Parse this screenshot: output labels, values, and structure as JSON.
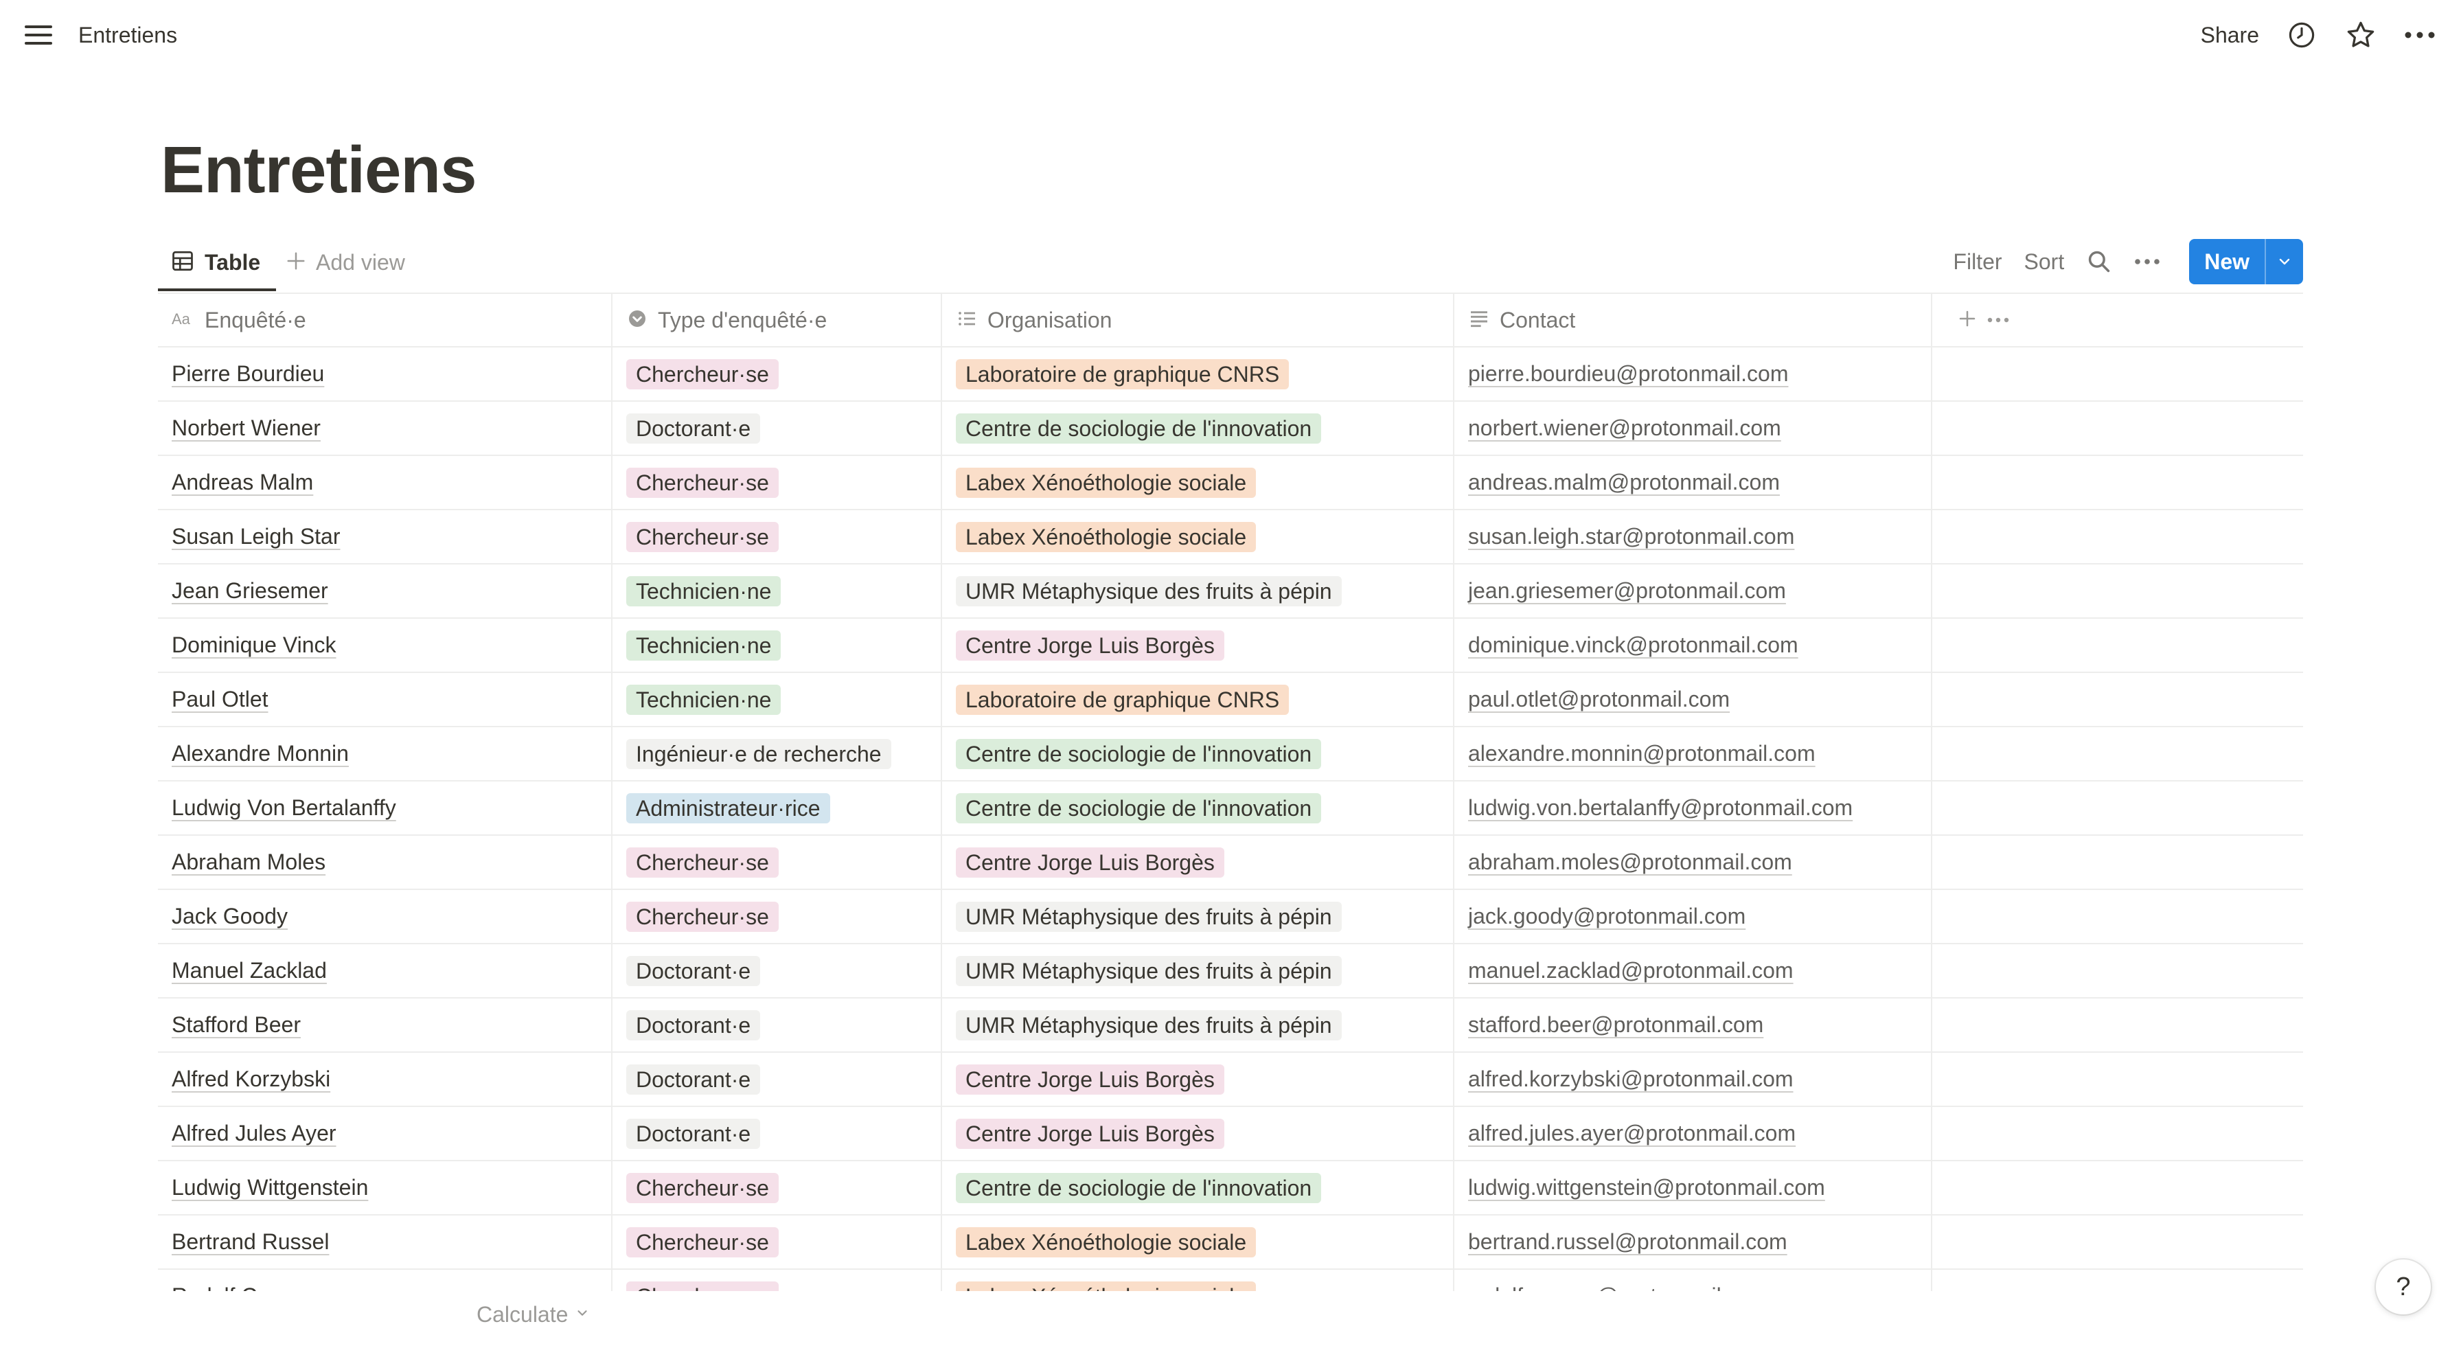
{
  "topbar": {
    "breadcrumb": "Entretiens",
    "share_label": "Share"
  },
  "page": {
    "title": "Entretiens"
  },
  "views": {
    "active_tab": "Table",
    "add_view_label": "Add view",
    "filter_label": "Filter",
    "sort_label": "Sort",
    "new_label": "New"
  },
  "columns": [
    {
      "label": "Enquêté·e",
      "icon": "text-aa-icon"
    },
    {
      "label": "Type d'enquêté·e",
      "icon": "select-icon"
    },
    {
      "label": "Organisation",
      "icon": "list-icon"
    },
    {
      "label": "Contact",
      "icon": "text-icon"
    }
  ],
  "tag_colors": {
    "pink": "#f5e0e9",
    "gray": "#f1f1ef",
    "green": "#dbeddb",
    "blue": "#d3e5ef",
    "orange": "#fadec9",
    "accent": "#2383e2"
  },
  "rows": [
    {
      "name": "Pierre Bourdieu",
      "type": "Chercheur·se",
      "type_color": "#f5e0e9",
      "org": "Laboratoire de graphique CNRS",
      "org_color": "#fadec9",
      "email": "pierre.bourdieu@protonmail.com"
    },
    {
      "name": "Norbert Wiener",
      "type": "Doctorant·e",
      "type_color": "#f1f1ef",
      "org": "Centre de sociologie de l'innovation",
      "org_color": "#dbeddb",
      "email": "norbert.wiener@protonmail.com"
    },
    {
      "name": "Andreas Malm",
      "type": "Chercheur·se",
      "type_color": "#f5e0e9",
      "org": "Labex Xénoéthologie sociale",
      "org_color": "#fadec9",
      "email": "andreas.malm@protonmail.com"
    },
    {
      "name": "Susan Leigh Star",
      "type": "Chercheur·se",
      "type_color": "#f5e0e9",
      "org": "Labex Xénoéthologie sociale",
      "org_color": "#fadec9",
      "email": "susan.leigh.star@protonmail.com"
    },
    {
      "name": "Jean Griesemer",
      "type": "Technicien·ne",
      "type_color": "#dbeddb",
      "org": "UMR Métaphysique des fruits à pépin",
      "org_color": "#f1f1ef",
      "email": "jean.griesemer@protonmail.com"
    },
    {
      "name": "Dominique Vinck",
      "type": "Technicien·ne",
      "type_color": "#dbeddb",
      "org": "Centre Jorge Luis Borgès",
      "org_color": "#f5e0e9",
      "email": "dominique.vinck@protonmail.com"
    },
    {
      "name": "Paul Otlet",
      "type": "Technicien·ne",
      "type_color": "#dbeddb",
      "org": "Laboratoire de graphique CNRS",
      "org_color": "#fadec9",
      "email": "paul.otlet@protonmail.com"
    },
    {
      "name": "Alexandre Monnin",
      "type": "Ingénieur·e de recherche",
      "type_color": "#f1f1ef",
      "org": "Centre de sociologie de l'innovation",
      "org_color": "#dbeddb",
      "email": "alexandre.monnin@protonmail.com"
    },
    {
      "name": "Ludwig Von Bertalanffy",
      "type": "Administrateur·rice",
      "type_color": "#d3e5ef",
      "org": "Centre de sociologie de l'innovation",
      "org_color": "#dbeddb",
      "email": "ludwig.von.bertalanffy@protonmail.com"
    },
    {
      "name": "Abraham Moles",
      "type": "Chercheur·se",
      "type_color": "#f5e0e9",
      "org": "Centre Jorge Luis Borgès",
      "org_color": "#f5e0e9",
      "email": "abraham.moles@protonmail.com"
    },
    {
      "name": "Jack Goody",
      "type": "Chercheur·se",
      "type_color": "#f5e0e9",
      "org": "UMR Métaphysique des fruits à pépin",
      "org_color": "#f1f1ef",
      "email": "jack.goody@protonmail.com"
    },
    {
      "name": "Manuel Zacklad",
      "type": "Doctorant·e",
      "type_color": "#f1f1ef",
      "org": "UMR Métaphysique des fruits à pépin",
      "org_color": "#f1f1ef",
      "email": "manuel.zacklad@protonmail.com"
    },
    {
      "name": "Stafford Beer",
      "type": "Doctorant·e",
      "type_color": "#f1f1ef",
      "org": "UMR Métaphysique des fruits à pépin",
      "org_color": "#f1f1ef",
      "email": "stafford.beer@protonmail.com"
    },
    {
      "name": "Alfred Korzybski",
      "type": "Doctorant·e",
      "type_color": "#f1f1ef",
      "org": "Centre Jorge Luis Borgès",
      "org_color": "#f5e0e9",
      "email": "alfred.korzybski@protonmail.com"
    },
    {
      "name": "Alfred Jules Ayer",
      "type": "Doctorant·e",
      "type_color": "#f1f1ef",
      "org": "Centre Jorge Luis Borgès",
      "org_color": "#f5e0e9",
      "email": "alfred.jules.ayer@protonmail.com"
    },
    {
      "name": "Ludwig Wittgenstein",
      "type": "Chercheur·se",
      "type_color": "#f5e0e9",
      "org": "Centre de sociologie de l'innovation",
      "org_color": "#dbeddb",
      "email": "ludwig.wittgenstein@protonmail.com"
    },
    {
      "name": "Bertrand Russel",
      "type": "Chercheur·se",
      "type_color": "#f5e0e9",
      "org": "Labex Xénoéthologie sociale",
      "org_color": "#fadec9",
      "email": "bertrand.russel@protonmail.com"
    },
    {
      "name": "Rudolf Carnap",
      "type": "Chercheur·se",
      "type_color": "#f5e0e9",
      "org": "Labex Xénoéthologie sociale",
      "org_color": "#fadec9",
      "email": "rudolf.carnap@protonmail.com"
    }
  ],
  "footer": {
    "calculate_label": "Calculate",
    "help_label": "?"
  }
}
